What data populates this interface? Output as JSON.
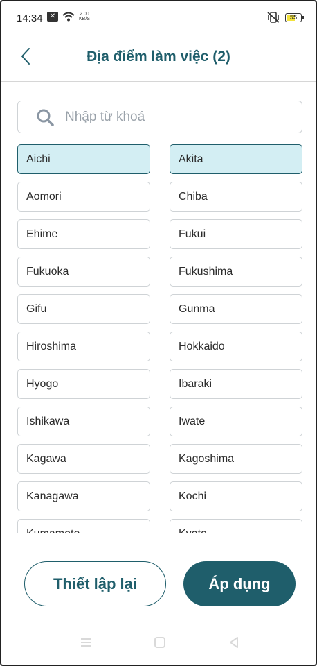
{
  "status_bar": {
    "time": "14:34",
    "network_speed_value": "2.00",
    "network_speed_unit": "KB/S",
    "battery_level": "55"
  },
  "header": {
    "title": "Địa điểm làm việc (2)",
    "back_icon": "chevron-left-icon"
  },
  "search": {
    "placeholder": "Nhập từ khoá",
    "value": "",
    "icon": "search-icon"
  },
  "locations": [
    {
      "label": "Aichi",
      "selected": true
    },
    {
      "label": "Akita",
      "selected": true
    },
    {
      "label": "Aomori",
      "selected": false
    },
    {
      "label": "Chiba",
      "selected": false
    },
    {
      "label": "Ehime",
      "selected": false
    },
    {
      "label": "Fukui",
      "selected": false
    },
    {
      "label": "Fukuoka",
      "selected": false
    },
    {
      "label": "Fukushima",
      "selected": false
    },
    {
      "label": "Gifu",
      "selected": false
    },
    {
      "label": "Gunma",
      "selected": false
    },
    {
      "label": "Hiroshima",
      "selected": false
    },
    {
      "label": "Hokkaido",
      "selected": false
    },
    {
      "label": "Hyogo",
      "selected": false
    },
    {
      "label": "Ibaraki",
      "selected": false
    },
    {
      "label": "Ishikawa",
      "selected": false
    },
    {
      "label": "Iwate",
      "selected": false
    },
    {
      "label": "Kagawa",
      "selected": false
    },
    {
      "label": "Kagoshima",
      "selected": false
    },
    {
      "label": "Kanagawa",
      "selected": false
    },
    {
      "label": "Kochi",
      "selected": false
    },
    {
      "label": "Kumamoto",
      "selected": false
    },
    {
      "label": "Kyoto",
      "selected": false
    }
  ],
  "actions": {
    "reset_label": "Thiết lập lại",
    "apply_label": "Áp dụng"
  },
  "colors": {
    "primary": "#1f5e6b",
    "selected_bg": "#d3eef3",
    "border": "#cfd3d6"
  }
}
